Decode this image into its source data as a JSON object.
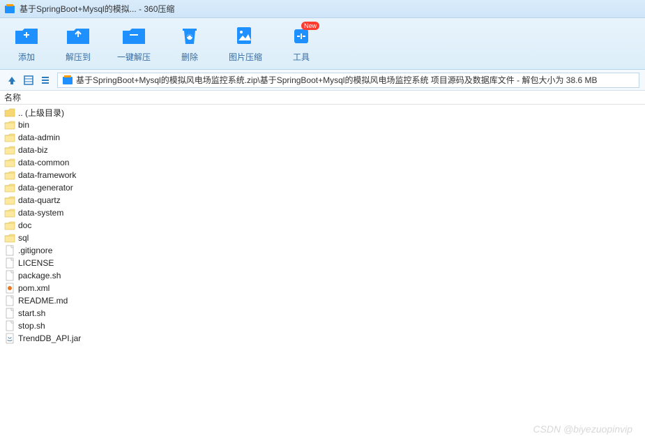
{
  "titlebar": {
    "text": "基于SpringBoot+Mysql的模拟... - 360压缩"
  },
  "toolbar": {
    "items": [
      {
        "label": "添加",
        "icon": "add-icon"
      },
      {
        "label": "解压到",
        "icon": "extract-icon"
      },
      {
        "label": "一键解压",
        "icon": "oneclick-icon"
      },
      {
        "label": "删除",
        "icon": "delete-icon"
      },
      {
        "label": "图片压缩",
        "icon": "image-icon"
      },
      {
        "label": "工具",
        "icon": "tools-icon",
        "badge": "New"
      }
    ]
  },
  "pathbar": {
    "text": "基于SpringBoot+Mysql的模拟风电场监控系统.zip\\基于SpringBoot+Mysql的模拟风电场监控系统 项目源码及数据库文件 - 解包大小为 38.6 MB"
  },
  "columns": {
    "name": "名称"
  },
  "files": [
    {
      "name": ".. (上级目录)",
      "type": "up"
    },
    {
      "name": "bin",
      "type": "folder"
    },
    {
      "name": "data-admin",
      "type": "folder"
    },
    {
      "name": "data-biz",
      "type": "folder"
    },
    {
      "name": "data-common",
      "type": "folder"
    },
    {
      "name": "data-framework",
      "type": "folder"
    },
    {
      "name": "data-generator",
      "type": "folder"
    },
    {
      "name": "data-quartz",
      "type": "folder"
    },
    {
      "name": "data-system",
      "type": "folder"
    },
    {
      "name": "doc",
      "type": "folder"
    },
    {
      "name": "sql",
      "type": "folder"
    },
    {
      "name": ".gitignore",
      "type": "file"
    },
    {
      "name": "LICENSE",
      "type": "file"
    },
    {
      "name": "package.sh",
      "type": "file"
    },
    {
      "name": "pom.xml",
      "type": "xml"
    },
    {
      "name": "README.md",
      "type": "file"
    },
    {
      "name": "start.sh",
      "type": "file"
    },
    {
      "name": "stop.sh",
      "type": "file"
    },
    {
      "name": "TrendDB_API.jar",
      "type": "jar"
    }
  ],
  "watermark": "CSDN @biyezuopinvip"
}
